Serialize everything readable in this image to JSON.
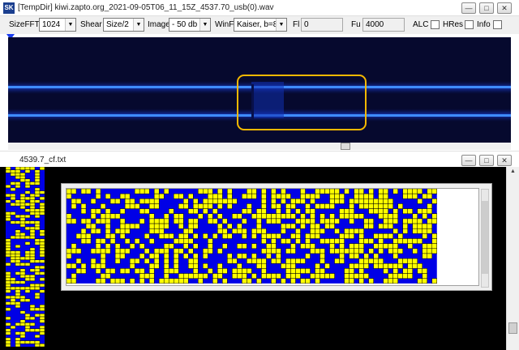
{
  "window1": {
    "title": "[TempDir] kiwi.zapto.org_2021-09-05T06_11_15Z_4537.70_usb(0).wav",
    "icon_name": "app-logo-icon",
    "controls": {
      "minimize": "—",
      "maximize": "□",
      "close": "✕"
    }
  },
  "toolbar": {
    "sizefft_label": "SizeFFT",
    "sizefft_value": "1024",
    "shear_label": "Shear",
    "shear_value": "Size/2",
    "image_label": "Image",
    "image_value": "- 50 db",
    "winf_label": "WinF",
    "winf_value": "Kaiser, b=8",
    "fl_label": "Fl",
    "fl_value": "0",
    "fu_label": "Fu",
    "fu_value": "4000",
    "alc_label": "ALC",
    "alc_checked": false,
    "hres_label": "HRes",
    "hres_checked": false,
    "info_label": "Info",
    "info_checked": false
  },
  "window2": {
    "title": "4539.7_cf.txt",
    "controls": {
      "minimize": "—",
      "maximize": "□",
      "close": "✕"
    }
  },
  "colors": {
    "spectrum_bg": "#06092e",
    "signal_line": "#3a86ff",
    "highlight_box": "#f5b800",
    "bit_one": "#ffff00",
    "bit_zero": "#0000e6",
    "grid_line": "#000000",
    "dark_bg": "#000000"
  }
}
